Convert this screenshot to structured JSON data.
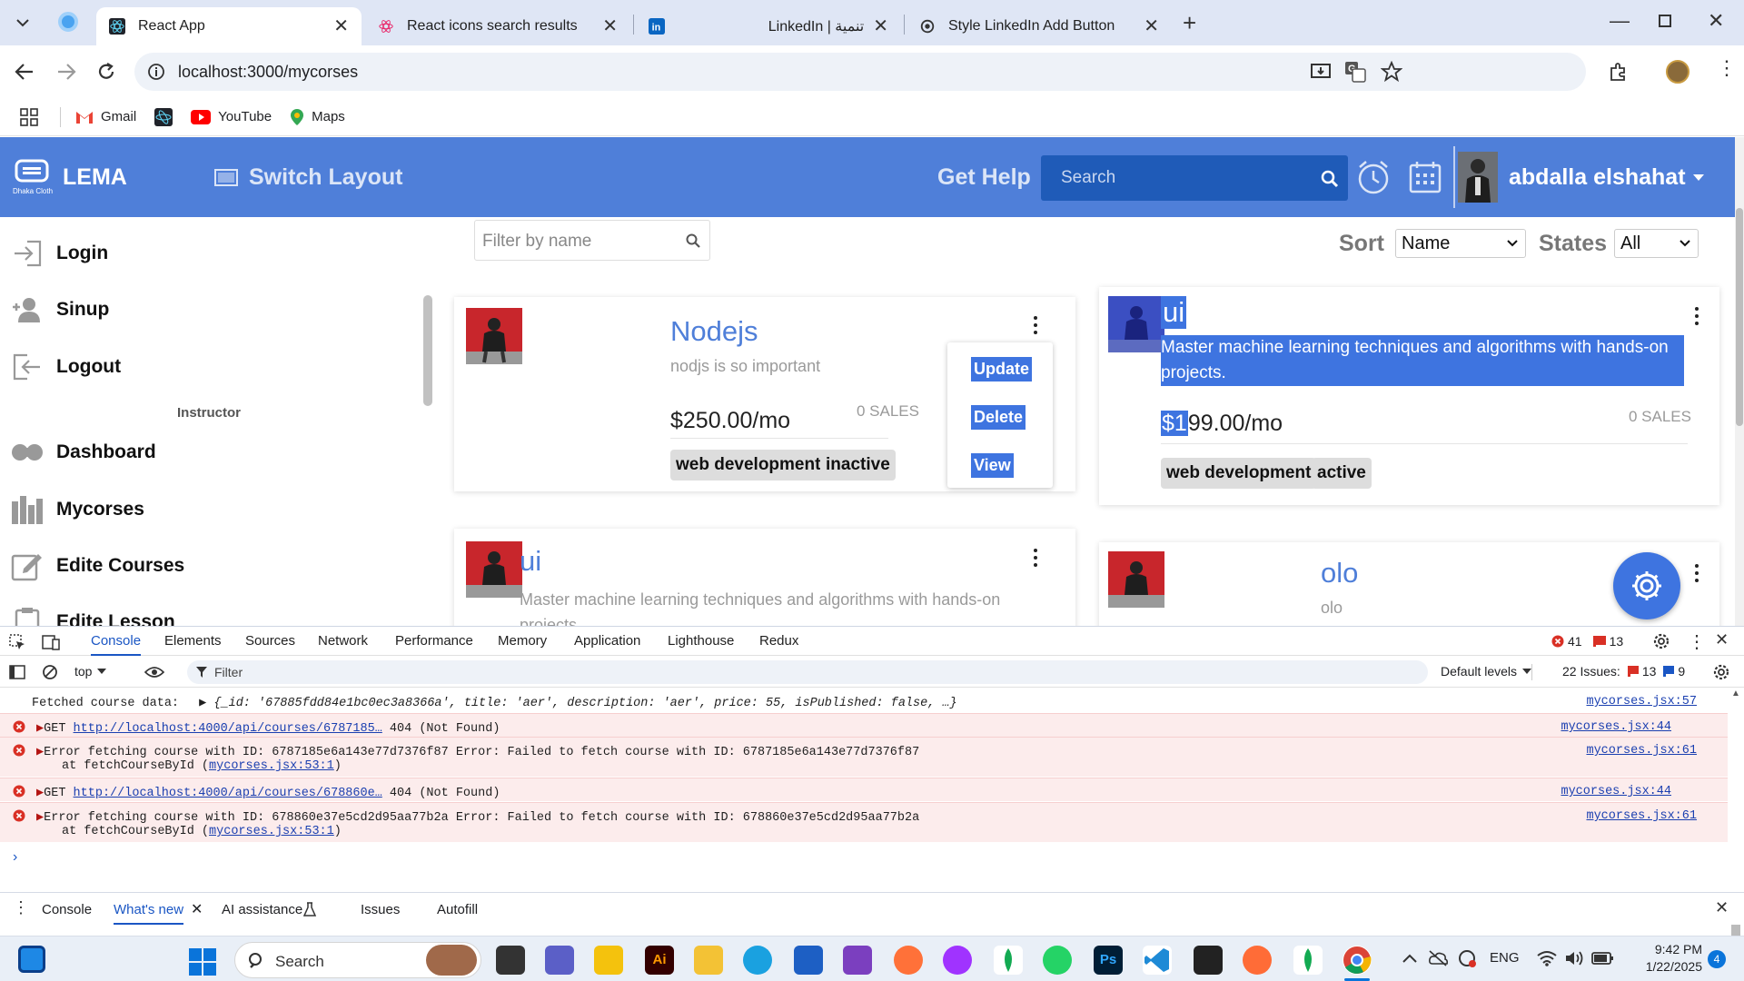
{
  "browser": {
    "tabs": [
      {
        "title": "React App",
        "active": true
      },
      {
        "title": "React icons search results",
        "active": false
      },
      {
        "title": "LinkedIn | تنمية",
        "active": false
      },
      {
        "title": "Style LinkedIn Add Button",
        "active": false
      }
    ],
    "url": "localhost:3000/mycorses",
    "bookmarks": [
      "Gmail",
      "YouTube",
      "Maps"
    ]
  },
  "app": {
    "logo_text": "LEMA",
    "logo_sub": "Dhaka Cloth",
    "switch_layout": "Switch Layout",
    "get_help": "Get Help",
    "search_placeholder": "Search",
    "username": "abdalla elshahat",
    "brand_color": "#4f7fd9"
  },
  "sidebar": {
    "items": [
      {
        "label": "Login",
        "icon": "login-icon"
      },
      {
        "label": "Sinup",
        "icon": "user-add-icon"
      },
      {
        "label": "Logout",
        "icon": "logout-icon"
      },
      {
        "label": "Dashboard",
        "icon": "dashboard-icon"
      },
      {
        "label": "Mycorses",
        "icon": "courses-icon"
      },
      {
        "label": "Edite Courses",
        "icon": "edit-icon"
      },
      {
        "label": "Edite Lesson",
        "icon": "lesson-icon"
      }
    ],
    "section_label": "Instructor"
  },
  "filters": {
    "filter_placeholder": "Filter by name",
    "sort_label": "Sort",
    "sort_value": "Name",
    "states_label": "States",
    "states_value": "All"
  },
  "courses": [
    {
      "title": "Nodejs",
      "description": "nodjs is so important",
      "price": "$250.00/mo",
      "sales": "0 SALES",
      "tags": [
        "web development",
        "inactive"
      ]
    },
    {
      "title": "ui",
      "description": "Master machine learning techniques and algorithms with hands-on projects.",
      "price": "$199.00/mo",
      "sales": "0 SALES",
      "tags": [
        "web development",
        "active"
      ]
    },
    {
      "title": "ui",
      "description": "Master machine learning techniques and algorithms with hands-on projects."
    },
    {
      "title": "olo",
      "description": "olo"
    }
  ],
  "card_menu": {
    "update": "Update",
    "delete": "Delete",
    "view": "View"
  },
  "devtools": {
    "tabs": [
      "Console",
      "Elements",
      "Sources",
      "Network",
      "Performance",
      "Memory",
      "Application",
      "Lighthouse",
      "Redux"
    ],
    "error_count": "41",
    "warning_count": "13",
    "context": "top",
    "filter_placeholder": "Filter",
    "levels": "Default levels",
    "issues_label": "22 Issues:",
    "issues_err": "13",
    "issues_info": "9",
    "logs": [
      {
        "type": "log",
        "text": "Fetched course data:",
        "obj": "{_id: '67885fdd84e1bc0ec3a8366a', title: 'aer', description: 'aer', price: 55, isPublished: false, …}",
        "src": "mycorses.jsx:57"
      },
      {
        "type": "error",
        "prefix": "GET ",
        "link": "http://localhost:4000/api/courses/6787185…",
        "suffix": " 404 (Not Found)",
        "src": "mycorses.jsx:44"
      },
      {
        "type": "error",
        "text": "Error fetching course with ID: 6787185e6a143e77d7376f87 Error: Failed to fetch course with ID: 6787185e6a143e77d7376f87",
        "at": "at fetchCourseById (",
        "at_link": "mycorses.jsx:53:1",
        "src": "mycorses.jsx:61"
      },
      {
        "type": "error",
        "prefix": "GET ",
        "link": "http://localhost:4000/api/courses/678860e…",
        "suffix": " 404 (Not Found)",
        "src": "mycorses.jsx:44"
      },
      {
        "type": "error",
        "text": "Error fetching course with ID: 678860e37e5cd2d95aa77b2a Error: Failed to fetch course with ID: 678860e37e5cd2d95aa77b2a",
        "at": "at fetchCourseById (",
        "at_link": "mycorses.jsx:53:1",
        "src": "mycorses.jsx:61"
      }
    ],
    "drawer_tabs": [
      "Console",
      "What's new",
      "AI assistance",
      "Issues",
      "Autofill"
    ]
  },
  "taskbar": {
    "search_placeholder": "Search",
    "language": "ENG",
    "time": "9:42 PM",
    "date": "1/22/2025",
    "notif_count": "4"
  }
}
